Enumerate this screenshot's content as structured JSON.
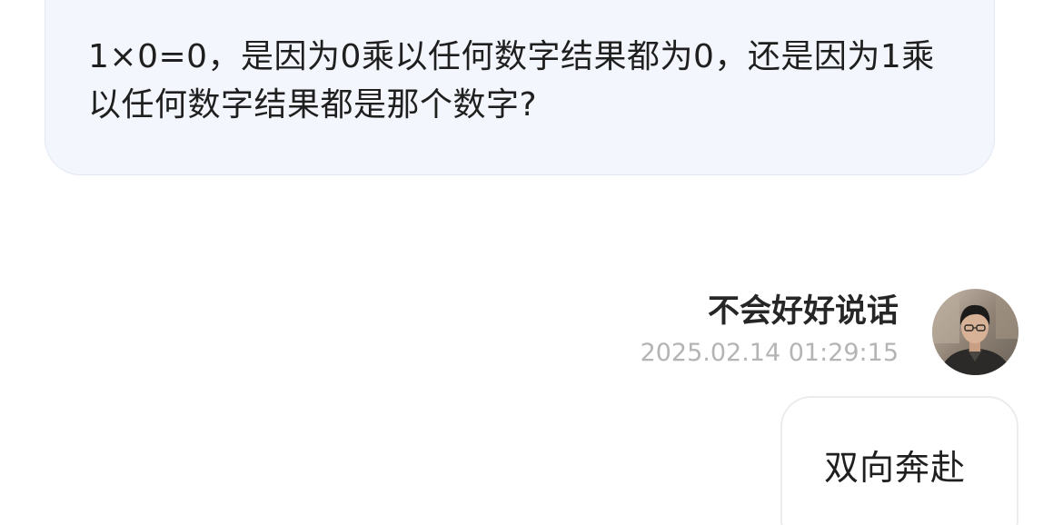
{
  "question": {
    "text": "1×0=0，是因为0乘以任何数字结果都为0，还是因为1乘以任何数字结果都是那个数字?"
  },
  "reply": {
    "author_name": "不会好好说话",
    "timestamp": "2025.02.14 01:29:15",
    "avatar_icon": "user-avatar-photo",
    "message": "双向奔赴"
  },
  "colors": {
    "question_bubble_bg": "#f3f6fc",
    "timestamp_text": "#b4b4b4"
  }
}
